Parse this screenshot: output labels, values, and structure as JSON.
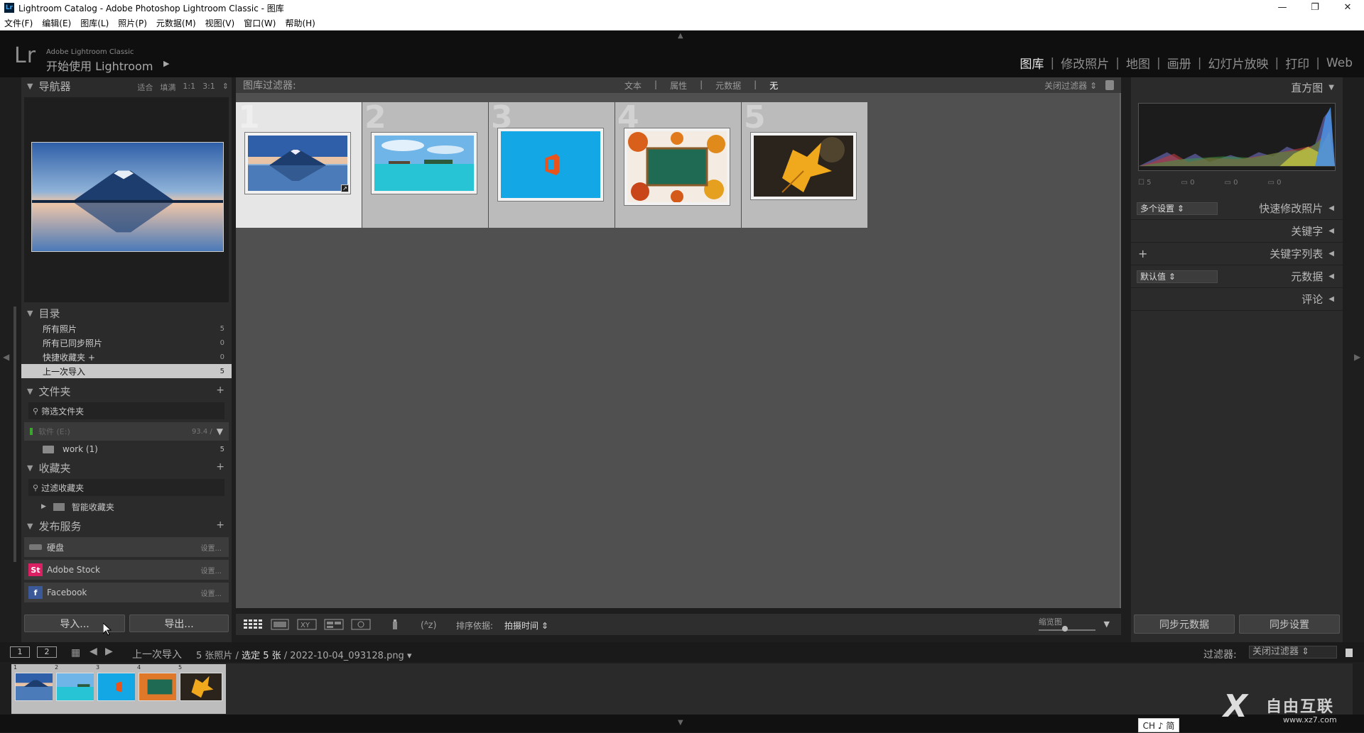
{
  "window": {
    "app_icon": "Lr",
    "title": "Lightroom Catalog - Adobe Photoshop Lightroom Classic - 图库",
    "buttons": [
      "—",
      "❐",
      "✕"
    ]
  },
  "menu": [
    "文件(F)",
    "编辑(E)",
    "图库(L)",
    "照片(P)",
    "元数据(M)",
    "视图(V)",
    "窗口(W)",
    "帮助(H)"
  ],
  "identity": {
    "logo": "Lr",
    "subtitle": "Adobe Lightroom Classic",
    "greeting": "开始使用 Lightroom",
    "arrow": "▶"
  },
  "modules": [
    {
      "label": "图库",
      "active": true
    },
    {
      "label": "修改照片",
      "active": false
    },
    {
      "label": "地图",
      "active": false
    },
    {
      "label": "画册",
      "active": false
    },
    {
      "label": "幻灯片放映",
      "active": false
    },
    {
      "label": "打印",
      "active": false
    },
    {
      "label": "Web",
      "active": false
    }
  ],
  "module_separator": "|",
  "left": {
    "navigator": {
      "title": "导航器",
      "options": [
        "适合",
        "填满",
        "1:1",
        "3:1",
        "⇕"
      ]
    },
    "catalog": {
      "title": "目录",
      "items": [
        {
          "label": "所有照片",
          "count": "5"
        },
        {
          "label": "所有已同步照片",
          "count": "0"
        },
        {
          "label": "快捷收藏夹 +",
          "count": "0"
        },
        {
          "label": "上一次导入",
          "count": "5"
        }
      ]
    },
    "folders": {
      "title": "文件夹",
      "filter_placeholder": "筛选文件夹",
      "volume": {
        "name": "软件 (E:)",
        "capacity": "93.4 /"
      },
      "items": [
        {
          "label": "work (1)",
          "count": "5"
        }
      ]
    },
    "collections": {
      "title": "收藏夹",
      "filter_placeholder": "过滤收藏夹",
      "items": [
        {
          "label": "智能收藏夹"
        }
      ]
    },
    "publish": {
      "title": "发布服务",
      "items": [
        {
          "label": "硬盘",
          "setting": "设置...",
          "icon": "St",
          "color": ""
        },
        {
          "label": "Adobe Stock",
          "setting": "设置...",
          "icon": "St",
          "color": "#da1f63"
        },
        {
          "label": "Facebook",
          "setting": "设置...",
          "icon": "f",
          "color": "#3b5998"
        }
      ]
    },
    "import_label": "导入...",
    "export_label": "导出..."
  },
  "filterbar": {
    "label": "图库过滤器:",
    "tabs": [
      {
        "label": "文本",
        "on": false
      },
      {
        "label": "属性",
        "on": false
      },
      {
        "label": "元数据",
        "on": false
      },
      {
        "label": "无",
        "on": true
      }
    ],
    "right": "关闭过滤器 ⇕"
  },
  "grid": {
    "cells": [
      {
        "num": "1",
        "selected": true,
        "image": "mountain-lake-icon"
      },
      {
        "num": "2",
        "selected": false,
        "image": "tropical-beach-icon"
      },
      {
        "num": "3",
        "selected": false,
        "image": "office-logo-icon"
      },
      {
        "num": "4",
        "selected": false,
        "image": "autumn-leaves-board-icon"
      },
      {
        "num": "5",
        "selected": false,
        "image": "yellow-leaf-icon"
      }
    ]
  },
  "toolbar": {
    "sort_label": "排序依据:",
    "sort_value": "拍摄时间 ⇕",
    "zoom_label": "缩览图",
    "dropdown": "▼"
  },
  "right": {
    "histogram": {
      "title": "直方图",
      "info": [
        "☐ 5",
        "▭ 0",
        "▭ 0",
        "▭ 0"
      ]
    },
    "sections": [
      {
        "title": "快速修改照片",
        "dropdown": "多个设置 ⇕",
        "plus": ""
      },
      {
        "title": "关键字",
        "dropdown": "",
        "plus": ""
      },
      {
        "title": "关键字列表",
        "dropdown": "",
        "plus": "+"
      },
      {
        "title": "元数据",
        "dropdown": "默认值 ⇕",
        "plus": ""
      },
      {
        "title": "评论",
        "dropdown": "",
        "plus": ""
      }
    ],
    "sync_meta_label": "同步元数据",
    "sync_settings_label": "同步设置"
  },
  "filmstrip": {
    "page1": "1",
    "page2": "2",
    "source": "上一次导入",
    "count_text": "5 张照片 /",
    "selected_text": "选定 5 张",
    "filename": "/ 2022-10-04_093128.png ▾",
    "filter_label": "过滤器:",
    "filter_value": "关闭过滤器 ⇕",
    "thumbs": [
      {
        "num": "1",
        "selected": true
      },
      {
        "num": "2",
        "selected": true
      },
      {
        "num": "3",
        "selected": true
      },
      {
        "num": "4",
        "selected": true
      },
      {
        "num": "5",
        "selected": true
      }
    ]
  },
  "ime": "CH ♪ 简",
  "watermark": {
    "mark": "X",
    "name": "自由互联",
    "url": "www.xz7.com"
  }
}
